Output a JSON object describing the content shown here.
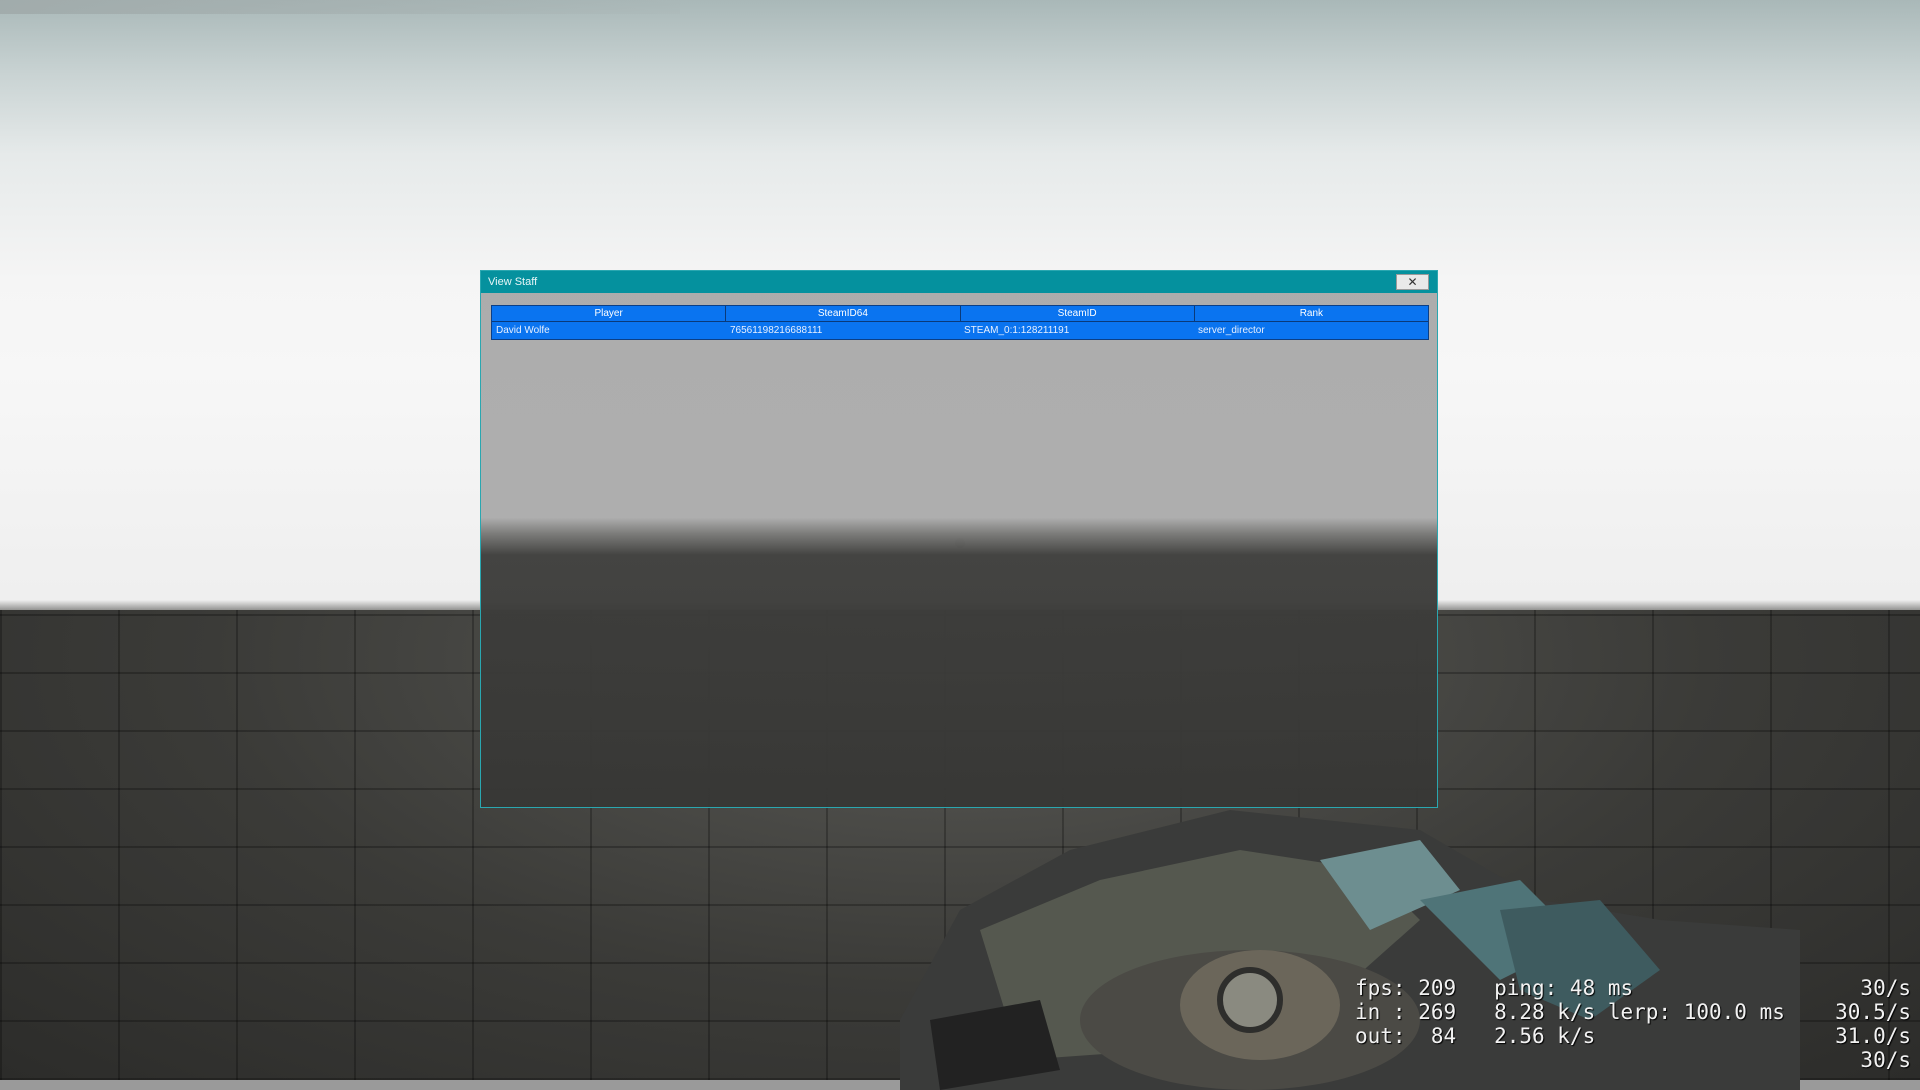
{
  "window": {
    "title": "View Staff",
    "close_glyph": "✕"
  },
  "table": {
    "columns": [
      "Player",
      "SteamID64",
      "SteamID",
      "Rank"
    ],
    "rows": [
      {
        "player": "David Wolfe",
        "steamid64": "76561198216688111",
        "steamid": "STEAM_0:1:128211191",
        "rank": "server_director"
      }
    ]
  },
  "netgraph": {
    "line1": "fps: 209   ping: 48 ms",
    "line2": "in : 269   8.28 k/s lerp: 100.0 ms",
    "line3": "out:  84   2.56 k/s",
    "rate1": "30/s",
    "rate2": "30.5/s",
    "rate3": "31.0/s",
    "rate4": "30/s"
  },
  "colors": {
    "titlebar": "#05919e",
    "table_selected": "#0a74f0"
  }
}
